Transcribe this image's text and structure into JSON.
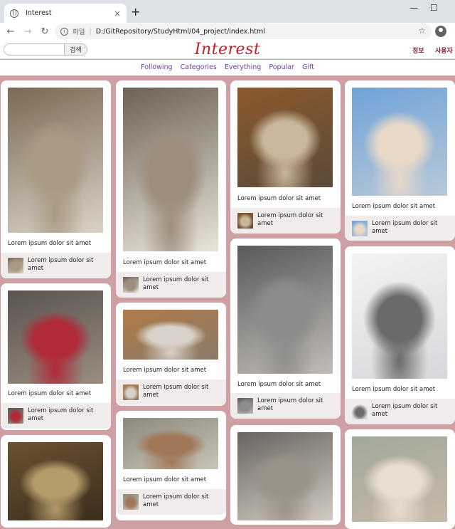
{
  "browser": {
    "tab_title": "Interest",
    "tab_close": "×",
    "new_tab": "+",
    "window_minimize": "—",
    "window_maximize": "☐",
    "window_close": "✕",
    "back": "←",
    "forward": "→",
    "reload": "↻",
    "info": "i",
    "address_label": "파일",
    "address_sep": "|",
    "address_path": "D:/GitRepository/StudyHtml/04_project/index.html",
    "bookmark": "☆"
  },
  "header": {
    "search_placeholder": "",
    "search_button": "검색",
    "logo": "Interest",
    "link_info": "정보",
    "link_user": "사용자"
  },
  "subnav": [
    "Following",
    "Categories",
    "Everything",
    "Popular",
    "Gift"
  ],
  "cards": [
    {
      "caption": "Lorem ipsum dolor sit amet",
      "author": "Lorem ipsum dolor sit amet",
      "photo_colors": [
        "#7a6a55",
        "#a89a84",
        "#d9d2c6"
      ]
    },
    {
      "caption": "Lorem ipsum dolor sit amet",
      "author": "Lorem ipsum dolor sit amet",
      "photo_colors": [
        "#6d6256",
        "#9c8e7d",
        "#e9e4d8"
      ]
    },
    {
      "caption": "Lorem ipsum dolor sit amet",
      "author": "Lorem ipsum dolor sit amet",
      "photo_colors": [
        "#8b5a2b",
        "#c9b79a",
        "#5b4a3a"
      ]
    },
    {
      "caption": "Lorem ipsum dolor sit amet",
      "author": "Lorem ipsum dolor sit amet",
      "photo_colors": [
        "#6fa3d8",
        "#e8d8c8",
        "#b8c8d8"
      ]
    },
    {
      "caption": "Lorem ipsum dolor sit amet",
      "author": "Lorem ipsum dolor sit amet",
      "photo_colors": [
        "#5a5550",
        "#b02a3a",
        "#9a8d80"
      ]
    },
    {
      "caption": "Lorem ipsum dolor sit amet",
      "author": "Lorem ipsum dolor sit amet",
      "photo_colors": [
        "#b07a45",
        "#d8d2ca",
        "#8a7a6a"
      ]
    },
    {
      "caption": "Lorem ipsum dolor sit amet",
      "author": "Lorem ipsum dolor sit amet",
      "photo_colors": [
        "#5a5a5c",
        "#8e8c8a",
        "#c0bcb6"
      ]
    },
    {
      "caption": "Lorem ipsum dolor sit amet",
      "author": "Lorem ipsum dolor sit amet",
      "photo_colors": [
        "#f3f3f5",
        "#6a6a6a",
        "#d8d8dc"
      ]
    },
    {
      "caption": "",
      "author": "",
      "photo_colors": [
        "#6b5230",
        "#b59a6a",
        "#3b2e1e"
      ]
    },
    {
      "caption": "Lorem ipsum dolor sit amet",
      "author": "Lorem ipsum dolor sit amet",
      "photo_colors": [
        "#8a8a7c",
        "#a07858",
        "#c9c3b8"
      ]
    },
    {
      "caption": "",
      "author": "",
      "photo_colors": [
        "#6a6560",
        "#9a9288",
        "#d0cac2"
      ]
    },
    {
      "caption": "",
      "author": "",
      "photo_colors": [
        "#a0a89a",
        "#e9dcd0",
        "#c8b8a8"
      ]
    }
  ]
}
